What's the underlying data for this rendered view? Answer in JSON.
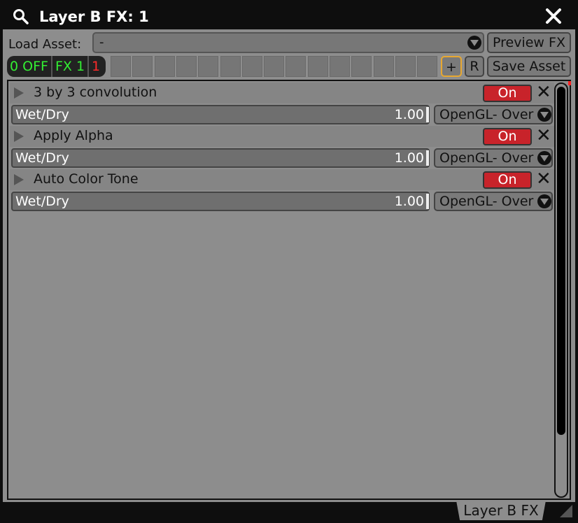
{
  "window": {
    "title": "Layer B FX: 1",
    "tab_label": "Layer B FX"
  },
  "toolbar": {
    "load_asset_label": "Load Asset:",
    "asset_value": "-",
    "preview_label": "Preview FX",
    "save_label": "Save Asset",
    "add_label": "+",
    "reset_label": "R"
  },
  "status": {
    "off": "0 OFF",
    "fx": "FX 1",
    "count": "1",
    "off_color": "#33ee33",
    "count_color": "#ff2a2a"
  },
  "effects": [
    {
      "name": "3 by 3 convolution",
      "state": "On",
      "param": "Wet/Dry",
      "value": "1.00",
      "blend": "OpenGL- Over"
    },
    {
      "name": "Apply Alpha",
      "state": "On",
      "param": "Wet/Dry",
      "value": "1.00",
      "blend": "OpenGL- Over"
    },
    {
      "name": "Auto Color Tone",
      "state": "On",
      "param": "Wet/Dry",
      "value": "1.00",
      "blend": "OpenGL- Over"
    }
  ]
}
